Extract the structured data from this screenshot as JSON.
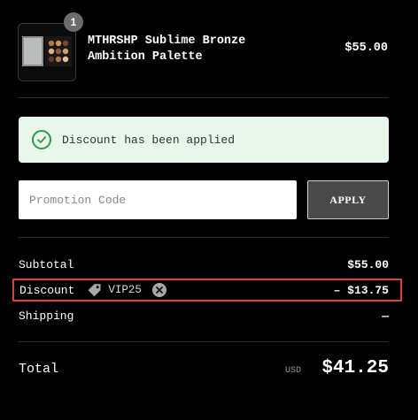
{
  "product": {
    "quantity": "1",
    "name": "MTHRSHP Sublime Bronze Ambition Palette",
    "price": "$55.00"
  },
  "notice": {
    "message": "Discount has been applied",
    "color": "#2c9a4b"
  },
  "promo": {
    "placeholder": "Promotion Code",
    "value": "",
    "apply_label": "APPLY"
  },
  "summary": {
    "subtotal_label": "Subtotal",
    "subtotal_value": "$55.00",
    "discount_label": "Discount",
    "discount_code": "VIP25",
    "discount_value": "– $13.75",
    "shipping_label": "Shipping",
    "shipping_value": "—"
  },
  "total": {
    "label": "Total",
    "currency": "USD",
    "value": "$41.25"
  },
  "colors": {
    "highlight_border": "#e53935",
    "background": "#000000"
  }
}
